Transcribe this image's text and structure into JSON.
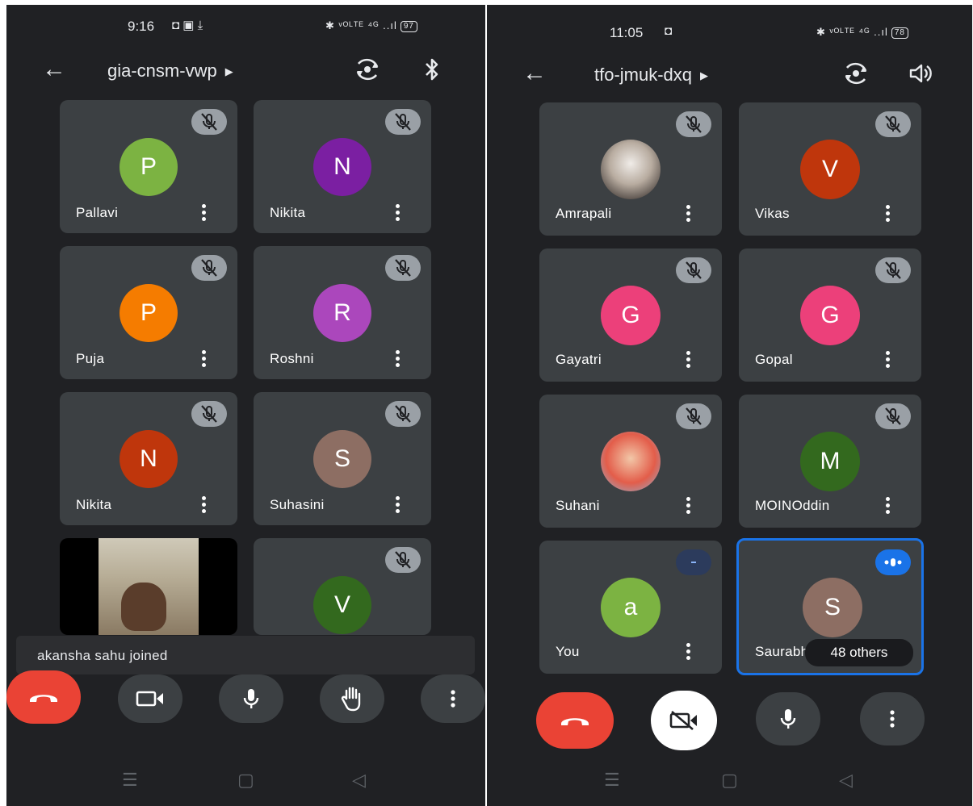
{
  "left": {
    "status_time": "9:16",
    "status_left_icons": "◘ ▣ ⤓",
    "status_right": "✱ ᵛᴼᴸᵀᴱ ⁴ᴳ ..ıl",
    "battery": "97",
    "meeting_code": "gia-cnsm-vwp",
    "tiles": [
      {
        "name": "Pallavi",
        "initial": "P",
        "color": "#7cb342"
      },
      {
        "name": "Nikita",
        "initial": "N",
        "color": "#7b1fa2"
      },
      {
        "name": "Puja",
        "initial": "P",
        "color": "#f57c00"
      },
      {
        "name": "Roshni",
        "initial": "R",
        "color": "#ab47bc"
      },
      {
        "name": "Nikita",
        "initial": "N",
        "color": "#bf360c"
      },
      {
        "name": "Suhasini",
        "initial": "S",
        "color": "#8d6e63"
      },
      {
        "name": "",
        "initial": "",
        "color": ""
      },
      {
        "name": "",
        "initial": "V",
        "color": "#33691e"
      }
    ],
    "toast": "akansha sahu joined"
  },
  "right": {
    "status_time": "11:05",
    "status_left_icons": "◘",
    "status_right": "✱ ᵛᴼᴸᵀᴱ ⁴ᴳ ..ıl",
    "battery": "78",
    "meeting_code": "tfo-jmuk-dxq",
    "tiles": [
      {
        "name": "Amrapali",
        "initial": "",
        "color": ""
      },
      {
        "name": "Vikas",
        "initial": "V",
        "color": "#bf360c"
      },
      {
        "name": "Gayatri",
        "initial": "G",
        "color": "#ec407a"
      },
      {
        "name": "Gopal",
        "initial": "G",
        "color": "#ec407a"
      },
      {
        "name": "Suhani",
        "initial": "",
        "color": ""
      },
      {
        "name": "MOINOddin",
        "initial": "M",
        "color": "#33691e"
      },
      {
        "name": "You",
        "initial": "a",
        "color": "#7cb342"
      },
      {
        "name": "Saurabh",
        "initial": "S",
        "color": "#8d6e63"
      }
    ],
    "others": "48 others"
  },
  "colors": {
    "bg": "#202124",
    "tile": "#3c4043",
    "end_call": "#ea4335",
    "speaking": "#1a73e8"
  }
}
